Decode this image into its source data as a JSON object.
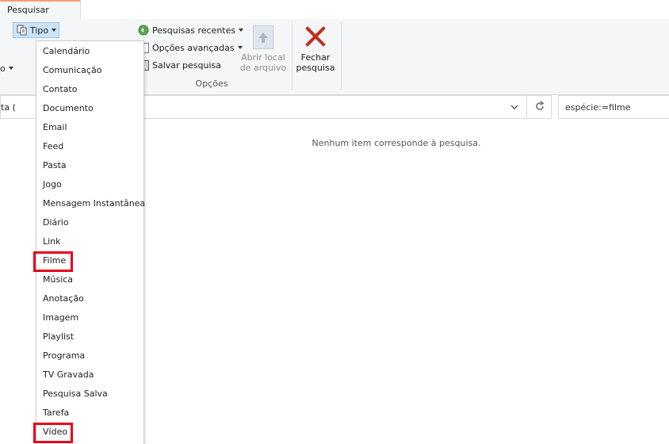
{
  "ribbon": {
    "tab_label": "Pesquisar",
    "tipo_label": "Tipo",
    "left_partial": "o",
    "recent_searches": "Pesquisas recentes",
    "advanced_options": "Opções avançadas",
    "save_search": "Salvar pesquisa",
    "options_group": "Opções",
    "open_location": [
      "Abrir local",
      "de arquivo"
    ],
    "close_search": [
      "Fechar",
      "pesquisa"
    ]
  },
  "address": {
    "partial_text": "ta (",
    "search_value": "espécie:=filme"
  },
  "main": {
    "empty_message": "Nenhum item corresponde à pesquisa."
  },
  "menu": {
    "items": [
      "Calendário",
      "Comunicação",
      "Contato",
      "Documento",
      "Email",
      "Feed",
      "Pasta",
      "Jogo",
      "Mensagem Instantânea",
      "Diário",
      "Link",
      "Filme",
      "Música",
      "Anotação",
      "Imagem",
      "Playlist",
      "Programa",
      "TV Gravada",
      "Pesquisa Salva",
      "Tarefa",
      "Vídeo"
    ],
    "highlighted": [
      "Filme",
      "Vídeo"
    ]
  },
  "colors": {
    "highlight": "#e8001c",
    "close_x": "#c42b1c",
    "selected_button": "#cce4f7"
  }
}
